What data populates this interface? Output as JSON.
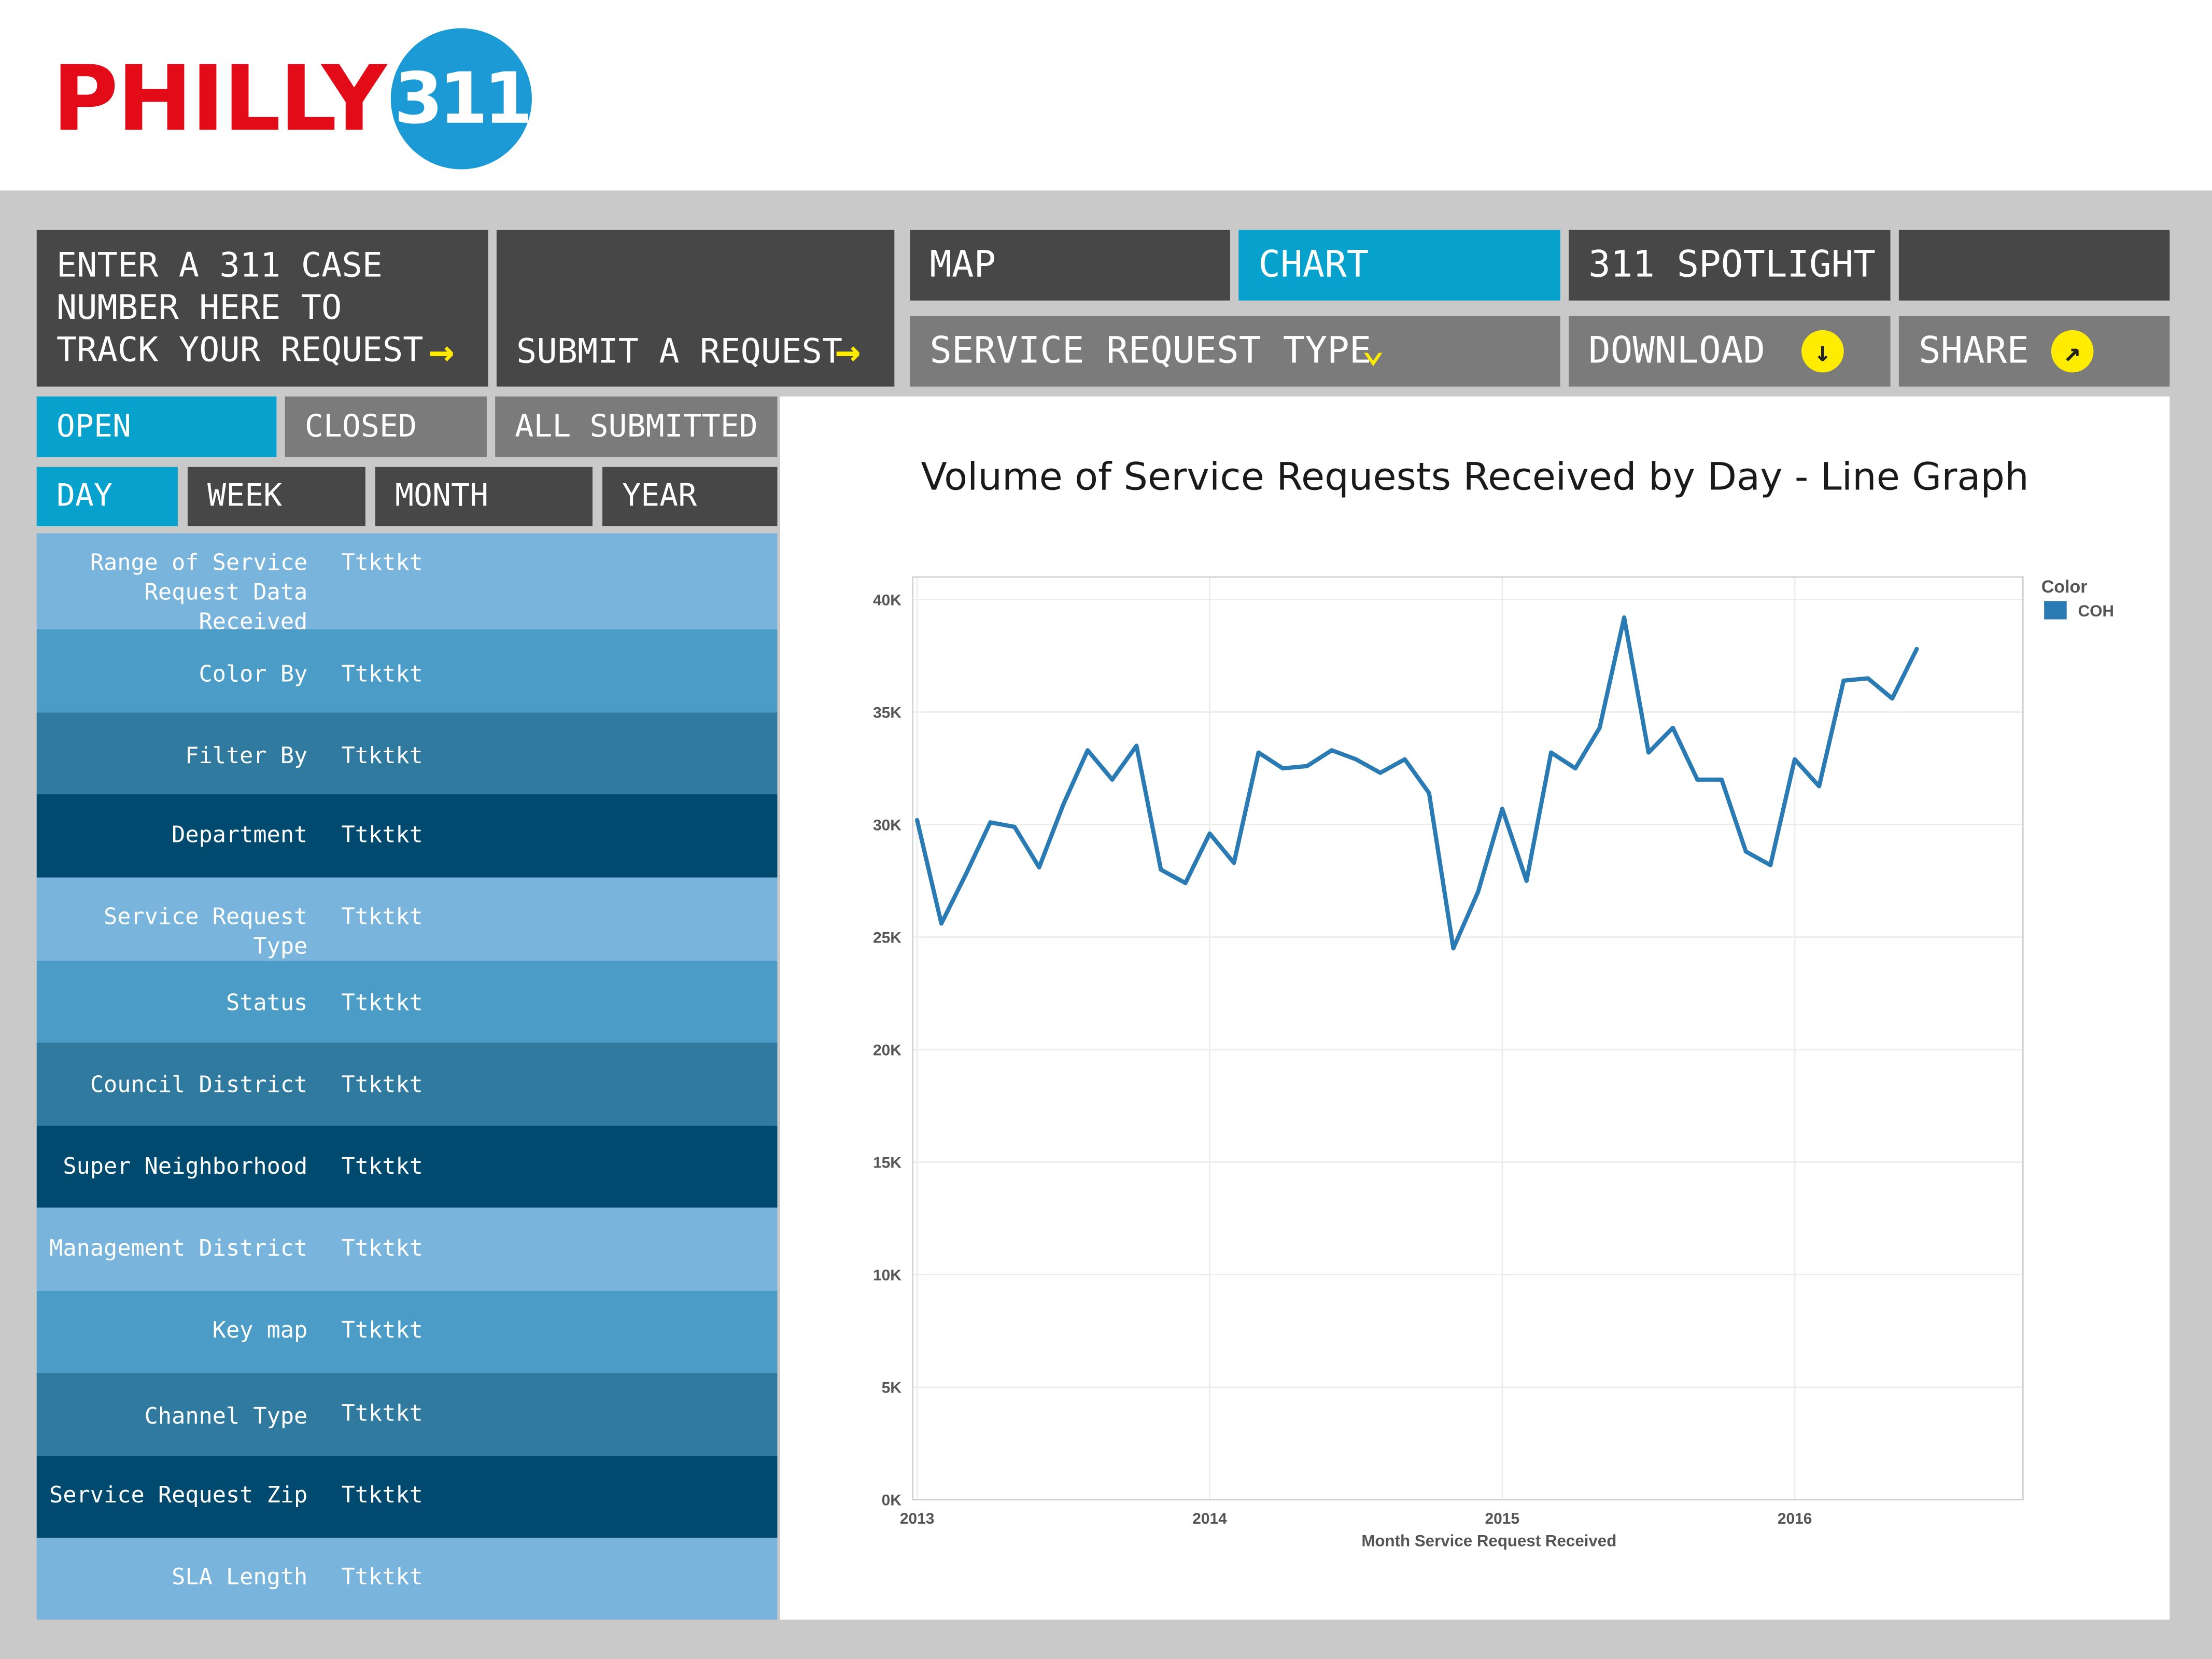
{
  "header": {
    "logo_text": "PHILLY",
    "logo_number": "311"
  },
  "nav": {
    "track": {
      "line1": "ENTER A 311 CASE",
      "line2": "NUMBER HERE TO",
      "line3": "TRACK YOUR REQUEST",
      "arrow": "→"
    },
    "submit": {
      "label": "SUBMIT A REQUEST",
      "arrow": "→"
    },
    "map": "MAP",
    "chart": "CHART",
    "spotlight": "311 SPOTLIGHT",
    "service_type": {
      "label": "SERVICE REQUEST TYPE",
      "icon": "⌄"
    },
    "download": {
      "label": "DOWNLOAD",
      "icon": "↓"
    },
    "share": {
      "label": "SHARE",
      "icon": "↗"
    }
  },
  "status_tabs": [
    "OPEN",
    "CLOSED",
    "ALL SUBMITTED"
  ],
  "period_tabs": [
    "DAY",
    "WEEK",
    "MONTH",
    "YEAR"
  ],
  "filters": [
    {
      "label": "Range of Service\nRequest Data Received",
      "value": "Ttktkt"
    },
    {
      "label": "Color By",
      "value": "Ttktkt"
    },
    {
      "label": "Filter By",
      "value": "Ttktkt"
    },
    {
      "label": "Department",
      "value": "Ttktkt"
    },
    {
      "label": "Service Request Type",
      "value": "Ttktkt"
    },
    {
      "label": "Status",
      "value": "Ttktkt"
    },
    {
      "label": "Council District",
      "value": "Ttktkt"
    },
    {
      "label": "Super Neighborhood",
      "value": "Ttktkt"
    },
    {
      "label": "Management District",
      "value": "Ttktkt"
    },
    {
      "label": "Key map",
      "value": "Ttktkt"
    },
    {
      "label": "Channel Type",
      "value": "Ttktkt"
    },
    {
      "label": "Service Request Zip",
      "value": "Ttktkt"
    },
    {
      "label": "SLA Length",
      "value": "Ttktkt"
    }
  ],
  "colors": {
    "brand_red": "#e30b17",
    "brand_blue": "#1b9ad6",
    "accent_cyan": "#06a1cc",
    "accent_yellow": "#ffec00",
    "line": "#2a7ab4"
  },
  "chart_data": {
    "type": "line",
    "title": "Volume of Service Requests Received by Day - Line Graph",
    "xlabel": "Month Service Request Received",
    "ylabel": "",
    "x_ticks": [
      "2013",
      "2014",
      "2015",
      "2016"
    ],
    "y_ticks": [
      "0K",
      "5K",
      "10K",
      "15K",
      "20K",
      "25K",
      "30K",
      "35K",
      "40K"
    ],
    "ylim": [
      0,
      41000
    ],
    "xlim": [
      2012.985,
      2016.78
    ],
    "grid": true,
    "legend": {
      "title": "Color",
      "placement": "top-right"
    },
    "series": [
      {
        "name": "COH",
        "color": "#2a7ab4",
        "x": [
          2013.0,
          2013.083,
          2013.167,
          2013.25,
          2013.333,
          2013.417,
          2013.5,
          2013.583,
          2013.667,
          2013.75,
          2013.833,
          2013.917,
          2014.0,
          2014.083,
          2014.167,
          2014.25,
          2014.333,
          2014.417,
          2014.5,
          2014.583,
          2014.667,
          2014.75,
          2014.833,
          2014.917,
          2015.0,
          2015.083,
          2015.167,
          2015.25,
          2015.333,
          2015.417,
          2015.5,
          2015.583,
          2015.667,
          2015.75,
          2015.833,
          2015.917,
          2016.0,
          2016.083,
          2016.167,
          2016.25,
          2016.333,
          2016.417
        ],
        "y": [
          30200,
          25600,
          27800,
          30100,
          29900,
          28100,
          30900,
          33300,
          32000,
          33500,
          28000,
          27400,
          29600,
          28300,
          33200,
          32500,
          32600,
          33300,
          32900,
          32300,
          32900,
          31400,
          24500,
          27000,
          30700,
          27500,
          33200,
          32500,
          34300,
          39200,
          33200,
          34300,
          32000,
          32000,
          28800,
          28200,
          32900,
          31700,
          36400,
          36500,
          35600,
          37800
        ]
      }
    ]
  }
}
